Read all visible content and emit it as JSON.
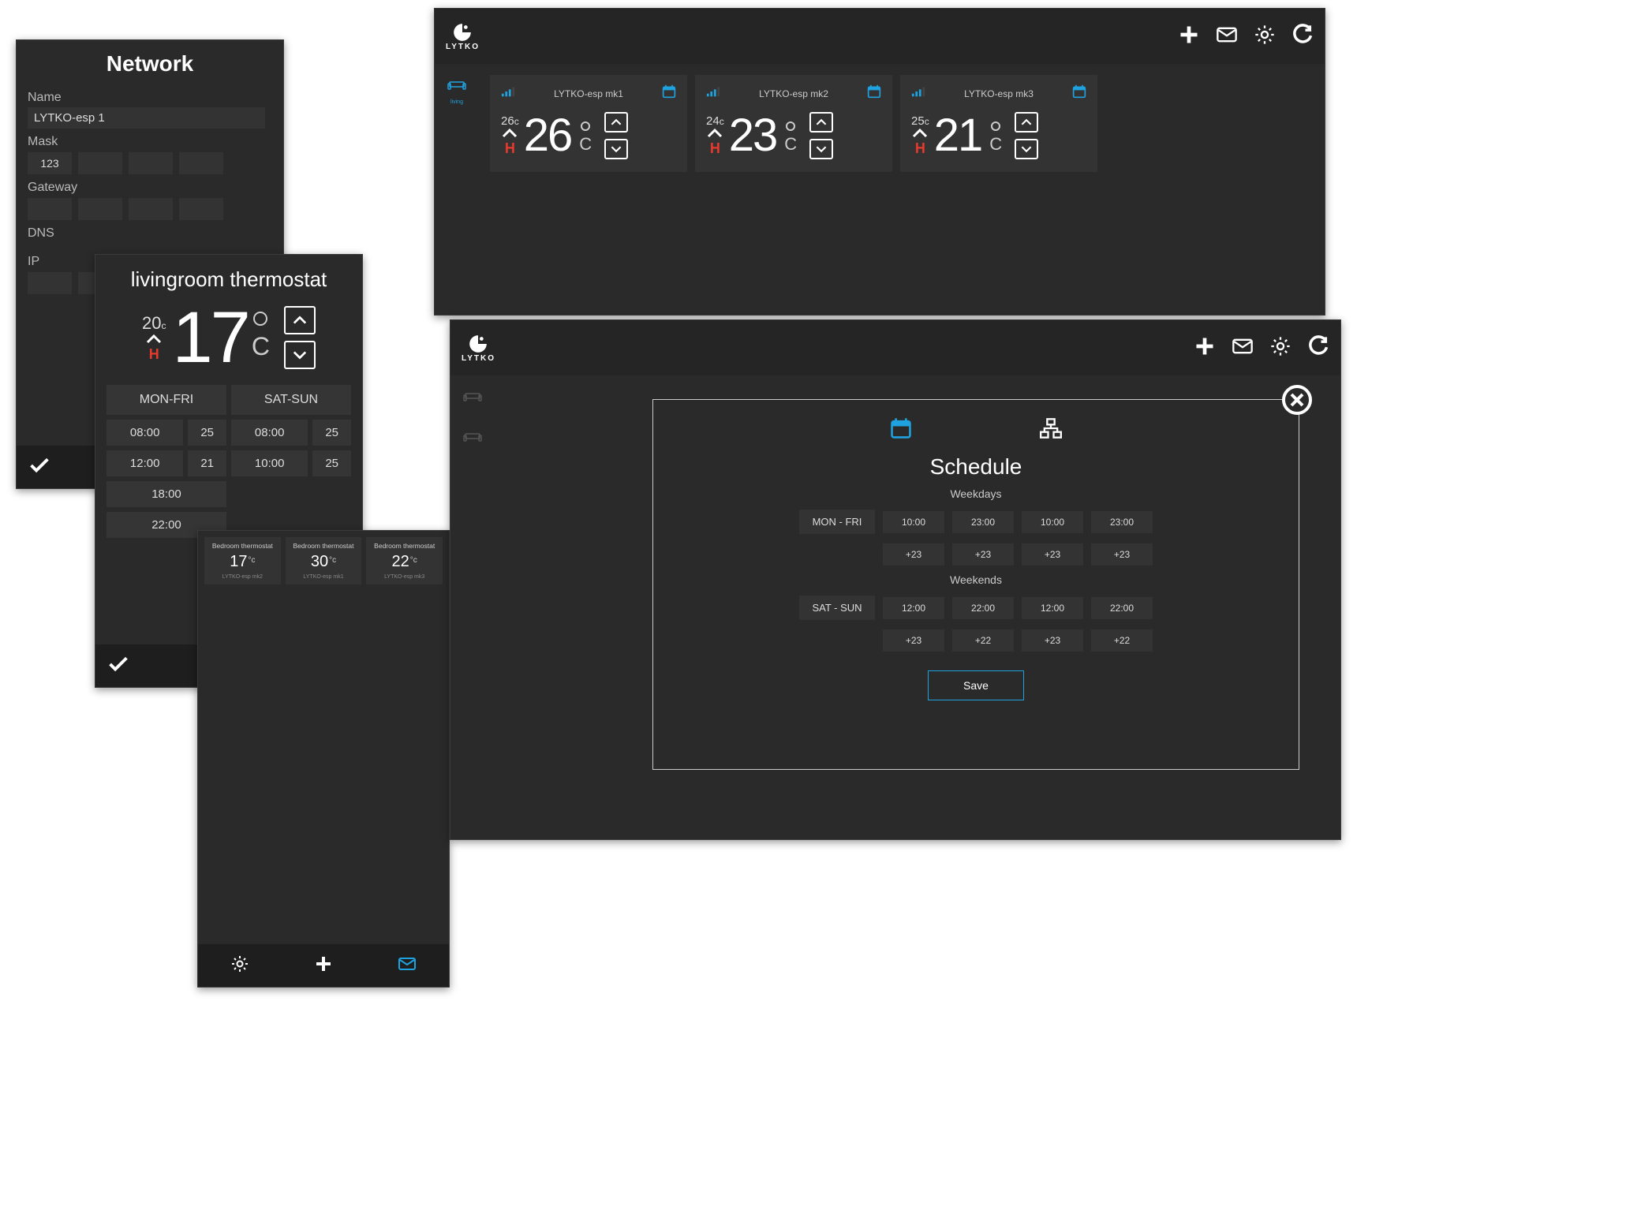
{
  "brand": "LYTKO",
  "colors": {
    "accent": "#1fa3e0",
    "heat": "#e63a2f"
  },
  "network": {
    "title": "Network",
    "name_label": "Name",
    "name_value": "LYTKO-esp 1",
    "mask_label": "Mask",
    "mask_value": "123",
    "gateway_label": "Gateway",
    "dns_label": "DNS",
    "ip_label": "IP"
  },
  "thermostat": {
    "title": "livingroom thermostat",
    "setpoint": "20",
    "setpoint_unit": "c",
    "mode": "H",
    "current": "17",
    "unit": "C",
    "tabs": [
      "MON-FRI",
      "SAT-SUN"
    ],
    "weekday_rows": [
      {
        "time": "08:00",
        "temp": "25"
      },
      {
        "time": "12:00",
        "temp": "21"
      },
      {
        "time": "18:00",
        "temp": ""
      },
      {
        "time": "22:00",
        "temp": ""
      }
    ],
    "weekend_rows": [
      {
        "time": "08:00",
        "temp": "25"
      },
      {
        "time": "10:00",
        "temp": "25"
      }
    ]
  },
  "mini_thermos": [
    {
      "title": "Bedroom thermostat",
      "temp": "17",
      "device": "LYTKO-esp mk2"
    },
    {
      "title": "Bedroom thermostat",
      "temp": "30",
      "device": "LYTKO-esp mk1"
    },
    {
      "title": "Bedroom thermostat",
      "temp": "22",
      "device": "LYTKO-esp mk3"
    }
  ],
  "dashboard": {
    "sidebar_label": "living",
    "devices": [
      {
        "name": "LYTKO-esp mk1",
        "setpoint": "26",
        "current": "26"
      },
      {
        "name": "LYTKO-esp mk2",
        "setpoint": "24",
        "current": "23"
      },
      {
        "name": "LYTKO-esp mk3",
        "setpoint": "25",
        "current": "21"
      }
    ]
  },
  "schedule_modal": {
    "title": "Schedule",
    "weekdays_label": "Weekdays",
    "weekends_label": "Weekends",
    "weekdays": {
      "day": "MON - FRI",
      "times": [
        "10:00",
        "23:00",
        "10:00",
        "23:00"
      ],
      "temps": [
        "+23",
        "+23",
        "+23",
        "+23"
      ]
    },
    "weekends": {
      "day": "SAT - SUN",
      "times": [
        "12:00",
        "22:00",
        "12:00",
        "22:00"
      ],
      "temps": [
        "+23",
        "+22",
        "+23",
        "+22"
      ]
    },
    "save_label": "Save"
  }
}
